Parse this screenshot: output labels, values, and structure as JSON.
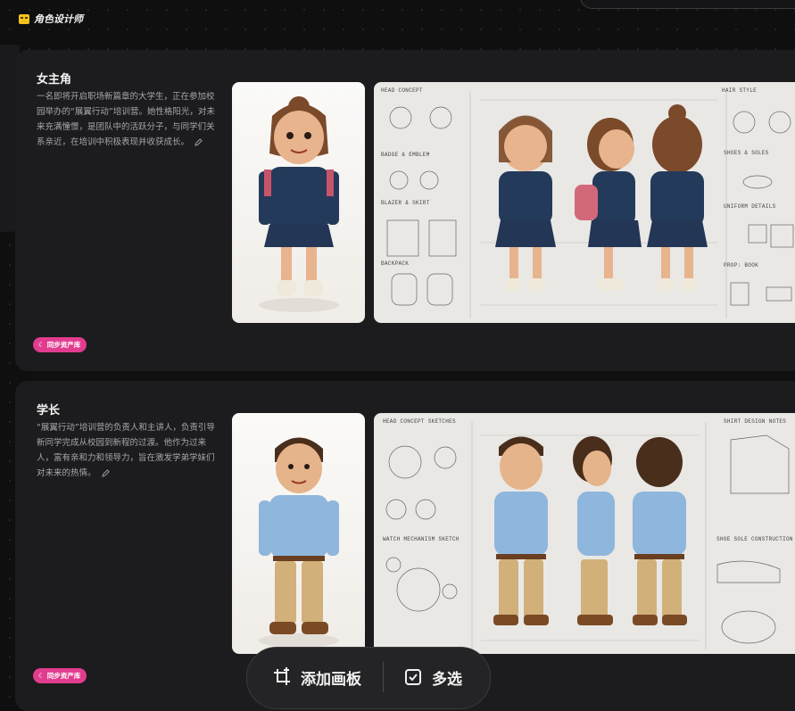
{
  "app": {
    "title": "角色设计师"
  },
  "cards": [
    {
      "name": "女主角",
      "description": "一名即将开启职场新篇章的大学生，正在参加校园举办的“展翼行动”培训营。她性格阳光，对未来充满憧憬，是团队中的活跃分子，与同学们关系亲近，在培训中积极表现并收获成长。",
      "sync_label": "同步资产库",
      "sheet_labels": [
        "HEAD CONCEPT",
        "BADGE & EMBLEM",
        "BLAZER & SKIRT",
        "BACKPACK",
        "HAIR STYLE",
        "SHOES & SOLES",
        "UNIFORM DETAILS",
        "PROP: BOOK"
      ]
    },
    {
      "name": "学长",
      "description": "“展翼行动”培训营的负责人和主讲人，负责引导新同学完成从校园到新程的过渡。他作为过来人，富有亲和力和领导力，旨在激发学弟学妹们对未来的热情。",
      "sync_label": "同步资产库",
      "sheet_labels": [
        "HEAD CONCEPT SKETCHES",
        "WATCH MECHANISM SKETCH",
        "SHIRT DESIGN NOTES",
        "SHOE SOLE CONSTRUCTION"
      ]
    }
  ],
  "toolbar": {
    "add_canvas": "添加画板",
    "multi_select": "多选"
  },
  "colors": {
    "accent_badge": "#e23c8f",
    "card_bg": "#1c1c1e",
    "page_bg": "#0f0f10"
  }
}
